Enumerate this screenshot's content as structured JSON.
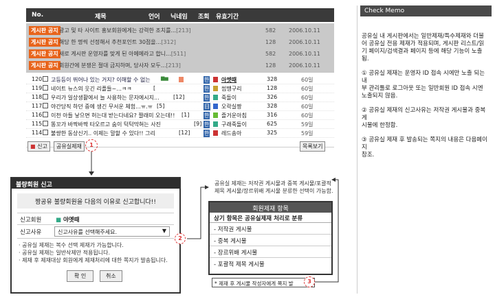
{
  "board": {
    "headers": {
      "no": "No.",
      "title": "제목",
      "lang": "언어",
      "nick": "닉네임",
      "views": "조회",
      "period": "유효기간"
    },
    "notices": [
      {
        "badge": "게시판 공지",
        "title": "광고 및 타 사이트 홍보회원에게는 강력한 조치를...",
        "cmt": "[213]",
        "views": "582",
        "date": "2006.10.11"
      },
      {
        "badge": "게시판 공지",
        "title": "해당 한 명씩 선정해서 추천포인트 30점을...",
        "cmt": "[312]",
        "views": "128",
        "date": "2006.10.11"
      },
      {
        "badge": "게시판 공지",
        "title": "새로 게시판 운영자를 맞게 된 아메메라고 합니...",
        "cmt": "[511]",
        "views": "582",
        "date": "2006.10.11"
      },
      {
        "badge": "게시판 공지",
        "title": "회원간에 분쟁은 절대 금지하며, 당사자 모두...",
        "cmt": "[213]",
        "views": "128",
        "date": "2006.10.11"
      }
    ],
    "rows": [
      {
        "no": "120",
        "title": "고등등이 뛰어나 있는 거지? 이해할 수 없는",
        "cmt": "",
        "lang": "한",
        "nick": "아멧때",
        "views": "328",
        "period": "60일"
      },
      {
        "no": "119",
        "title": "네이트 뉴스의 웃긴 리플들~...ㅋㅋ",
        "cmt": "[",
        "lang": "한",
        "nick": "씹땡구리",
        "views": "128",
        "period": "60일"
      },
      {
        "no": "118",
        "title": "우리가 일상생활에서 늘 사용하는 문자에시지...",
        "cmt": "[12]",
        "lang": "한",
        "nick": "죽돌이",
        "views": "326",
        "period": "60일"
      },
      {
        "no": "117",
        "title": "야간당직 하던 중에 생긴 무서운 체험...ㅠ.ㅠ",
        "cmt": "[5]",
        "lang": "日",
        "nick": "오락실짱",
        "views": "328",
        "period": "60일"
      },
      {
        "no": "116",
        "title": "이천 아들 낳으면 허는대 받는다네요? 짤래미 오는데!!",
        "cmt": "[1]",
        "lang": "한",
        "nick": "즐거운아침",
        "views": "316",
        "period": "60일"
      },
      {
        "no": "115",
        "title": "똥꼬가 바짝바짝 타오르고 숨이 턱턱막혀는 사진",
        "cmt": "[9]",
        "lang": "한",
        "nick": "구래죽돌이",
        "views": "625",
        "period": "59일"
      },
      {
        "no": "114",
        "title": "불쌍한 동상신기.. 이제는 말할 수 있다!! 그리",
        "cmt": "[12]",
        "lang": "한",
        "nick": "레드송아",
        "views": "325",
        "period": "59일"
      }
    ],
    "report_button": "신고",
    "block_button": "공유실제재",
    "list_button": "목록보기"
  },
  "dialog": {
    "title": "불량회원 신고",
    "prompt": "짱공유 불량회원을 다음의 이유로 신고합니다!!",
    "reporter_label": "신고회원",
    "reporter_value": "야옛때",
    "reason_label": "신고사유",
    "reason_placeholder": "신고사유를 선택해주세요.",
    "notes": [
      "· 공유실 제재는 복수 선택 제재가 가능합니다.",
      "· 공유실 제재는 일반삭제만 적용됩니다.",
      "· 제재 후 제재대상 회원에게 제재처리에 대한 쪽지가 발송됩니다."
    ],
    "ok": "확 인",
    "cancel": "취소"
  },
  "callout": {
    "text1": "공유실 제재는 저작권 게시물과 중복 게시물/포괄적",
    "text2": "제목 게시물/장르위배 게시물 분류한 선택이 가능함."
  },
  "member_box": {
    "title": "회원제재 항목",
    "subtitle": "상기 항목은 공유실제재 처리로 분류",
    "items": [
      "- 저작권 게시물",
      "- 중복 게시물",
      "- 장르위배 게시물",
      "- 포괄적 제목 게시물"
    ]
  },
  "footnote": "* 제재 후 게시물 작성자에게 쪽지 발",
  "markers": [
    "1",
    "2",
    "3"
  ],
  "memo": {
    "title": "Check Memo",
    "p1": "공유실 내 게시판에서는 일반제재/특수제재와 더불어 공유실 전용 제재가 적용되며, 게시판 리스트/읽기 페이지/검색결과 페이지 등에 해당 기능이 노출 됨.",
    "p2": "① 공유실 제재는 운영자 ID 접속 시에만 노출 되는 내\n  부 관리툴로 로그아웃 또는 일반회원 ID 접속 시엔\n  노출되지 않음.",
    "p3": "② 공유실 제재의 신고사유는 저작권 게시물과 중복 게\n  시물에 한정함.",
    "p4": "③ 공유실 제재 후 발송되는 쪽지의 내용은 다음페이지\n  참조."
  }
}
